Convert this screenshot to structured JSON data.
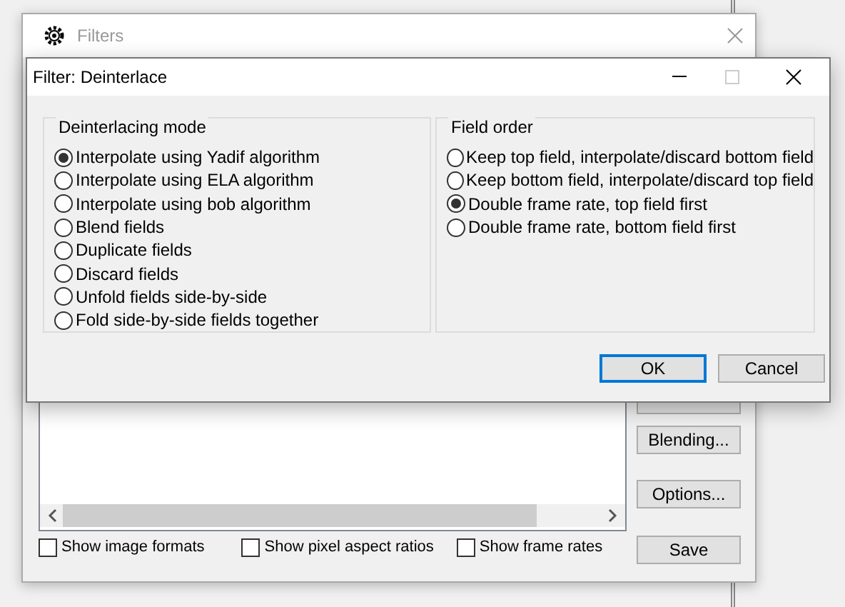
{
  "filters_window": {
    "title": "Filters",
    "buttons": [
      {
        "kind": "covered"
      },
      {
        "kind": "text",
        "label": "Blending..."
      },
      {
        "kind": "text",
        "label": "Options..."
      },
      {
        "kind": "text",
        "label": "Save"
      }
    ],
    "checkboxes": [
      {
        "label": "Show image formats",
        "checked": false
      },
      {
        "label": "Show pixel aspect ratios",
        "checked": false
      },
      {
        "label": "Show frame rates",
        "checked": false
      }
    ]
  },
  "dialog": {
    "title": "Filter: Deinterlace",
    "groups": [
      {
        "title": "Deinterlacing mode",
        "options": [
          {
            "label": "Interpolate using Yadif algorithm",
            "selected": true
          },
          {
            "label": "Interpolate using ELA algorithm",
            "selected": false
          },
          {
            "label": "Interpolate using bob algorithm",
            "selected": false
          },
          {
            "label": "Blend fields",
            "selected": false
          },
          {
            "label": "Duplicate fields",
            "selected": false
          },
          {
            "label": "Discard fields",
            "selected": false
          },
          {
            "label": "Unfold fields side-by-side",
            "selected": false
          },
          {
            "label": "Fold side-by-side fields together",
            "selected": false
          }
        ]
      },
      {
        "title": "Field order",
        "options": [
          {
            "label": "Keep top field, interpolate/discard bottom field",
            "selected": false
          },
          {
            "label": "Keep bottom field, interpolate/discard top field",
            "selected": false
          },
          {
            "label": "Double frame rate, top field first",
            "selected": true
          },
          {
            "label": "Double frame rate, bottom field first",
            "selected": false
          }
        ]
      }
    ],
    "buttons": [
      {
        "label": "OK",
        "focused": true
      },
      {
        "label": "Cancel",
        "focused": false
      }
    ]
  }
}
